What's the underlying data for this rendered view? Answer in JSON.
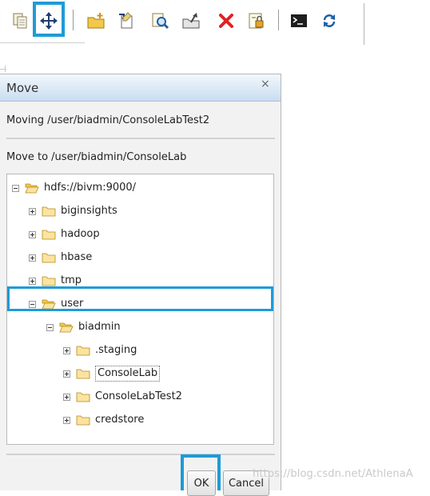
{
  "toolbar": {
    "buttons": [
      {
        "name": "copy-icon"
      },
      {
        "name": "move-icon"
      },
      {
        "name": "new-folder-icon"
      },
      {
        "name": "rename-icon"
      },
      {
        "name": "search-icon"
      },
      {
        "name": "upload-icon"
      },
      {
        "name": "delete-icon"
      },
      {
        "name": "permissions-icon"
      },
      {
        "name": "terminal-icon"
      },
      {
        "name": "refresh-icon"
      }
    ],
    "accent": "#1e9bd7"
  },
  "dialog": {
    "title": "Move",
    "close_glyph": "×",
    "moving_text": "Moving /user/biadmin/ConsoleLabTest2",
    "move_to_text": "Move to /user/biadmin/ConsoleLab",
    "tree": {
      "root": "hdfs://bivm:9000/",
      "level1": [
        "biginsights",
        "hadoop",
        "hbase",
        "tmp",
        "user"
      ],
      "user_child": "biadmin",
      "biadmin_children": [
        ".staging",
        "ConsoleLab",
        "ConsoleLabTest2",
        "credstore"
      ],
      "selected": "ConsoleLab"
    },
    "ok_label": "OK",
    "cancel_label": "Cancel"
  },
  "watermark": "https://blog.csdn.net/AthlenaA"
}
